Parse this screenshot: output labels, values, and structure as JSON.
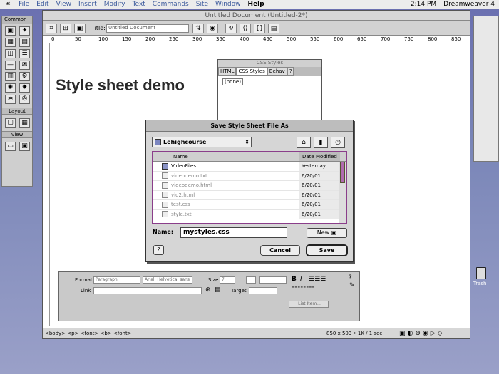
{
  "menubar": {
    "apple": "☙",
    "items": [
      "File",
      "Edit",
      "View",
      "Insert",
      "Modify",
      "Text",
      "Commands",
      "Site",
      "Window",
      "Help"
    ],
    "clock": "2:14 PM",
    "app": "Dreamweaver 4"
  },
  "objects_palette": {
    "category": "Common",
    "layout_label": "Layout",
    "view_label": "View"
  },
  "document": {
    "window_title": "Untitled Document (Untitled-2*)",
    "title_label": "Title:",
    "title_value": "Untitled Document",
    "ruler_ticks": [
      "0",
      "50",
      "100",
      "150",
      "200",
      "250",
      "300",
      "350",
      "400",
      "450",
      "500",
      "550",
      "600",
      "650",
      "700",
      "750",
      "800",
      "850"
    ],
    "heading": "Style sheet demo",
    "status_tags": "<body> <p> <font> <b> <font>",
    "status_size": "850 x 503 • 1K / 1 sec"
  },
  "css_panel": {
    "title": "CSS Styles",
    "tabs": [
      "HTML",
      "CSS Styles",
      "Behav"
    ],
    "item": "(none)"
  },
  "property_inspector": {
    "format_label": "Format",
    "format_value": "Paragraph",
    "font_value": "Arial, Helvetica, sans",
    "size_label": "Size",
    "size_value": "7",
    "link_label": "Link",
    "target_label": "Target",
    "list_item_label": "List Item..."
  },
  "save_dialog": {
    "title": "Save Style Sheet File As",
    "folder": "Lehighcourse",
    "col_name": "Name",
    "col_date": "Date Modified",
    "files": [
      {
        "name": "VideoFiles",
        "date": "Yesterday",
        "type": "folder",
        "enabled": true
      },
      {
        "name": "videodemo.txt",
        "date": "6/20/01",
        "type": "file",
        "enabled": false
      },
      {
        "name": "videodemo.html",
        "date": "6/20/01",
        "type": "file",
        "enabled": false
      },
      {
        "name": "vid2.html",
        "date": "6/20/01",
        "type": "file",
        "enabled": false
      },
      {
        "name": "test.css",
        "date": "6/20/01",
        "type": "file",
        "enabled": false
      },
      {
        "name": "style.txt",
        "date": "6/20/01",
        "type": "file",
        "enabled": false
      }
    ],
    "name_label": "Name:",
    "name_value": "mystyles.css",
    "new_label": "New",
    "help_label": "?",
    "cancel_label": "Cancel",
    "save_label": "Save"
  },
  "desktop": {
    "trash_label": "Trash"
  }
}
